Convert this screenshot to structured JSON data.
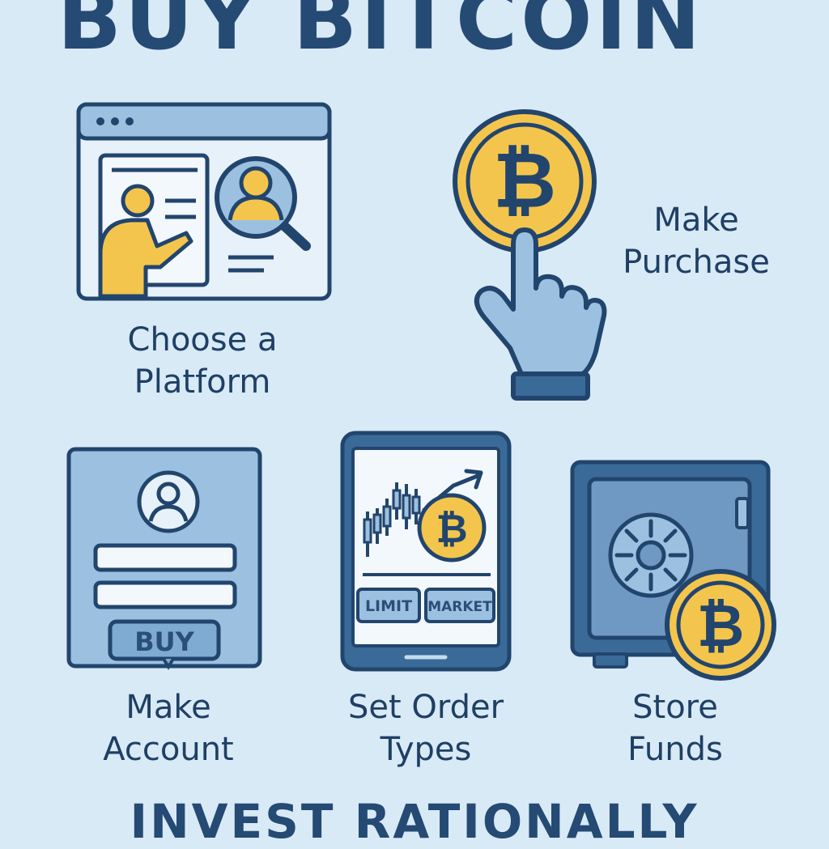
{
  "title": "BUY BITCOIN",
  "footer": "INVEST RATIONALLY",
  "steps": [
    {
      "id": "choose-platform",
      "line1": "Choose a",
      "line2": "Platform",
      "icon": "browser-profile-search-icon"
    },
    {
      "id": "make-purchase",
      "line1": "Make",
      "line2": "Purchase",
      "icon": "bitcoin-tap-icon"
    },
    {
      "id": "make-account",
      "line1": "Make",
      "line2": "Account",
      "icon": "account-form-icon",
      "button_label": "BUY"
    },
    {
      "id": "set-order-types",
      "line1": "Set Order",
      "line2": "Types",
      "icon": "trading-phone-icon",
      "order_buttons": [
        "LIMIT",
        "MARKET"
      ]
    },
    {
      "id": "store-funds",
      "line1": "Store",
      "line2": "Funds",
      "icon": "safe-bitcoin-icon"
    }
  ],
  "colors": {
    "background": "#d8eaf6",
    "text": "#1f3f64",
    "outline": "#22456d",
    "panel": "#9cc0e0",
    "light_panel": "#e6f1fa",
    "accent": "#f4c54d"
  }
}
